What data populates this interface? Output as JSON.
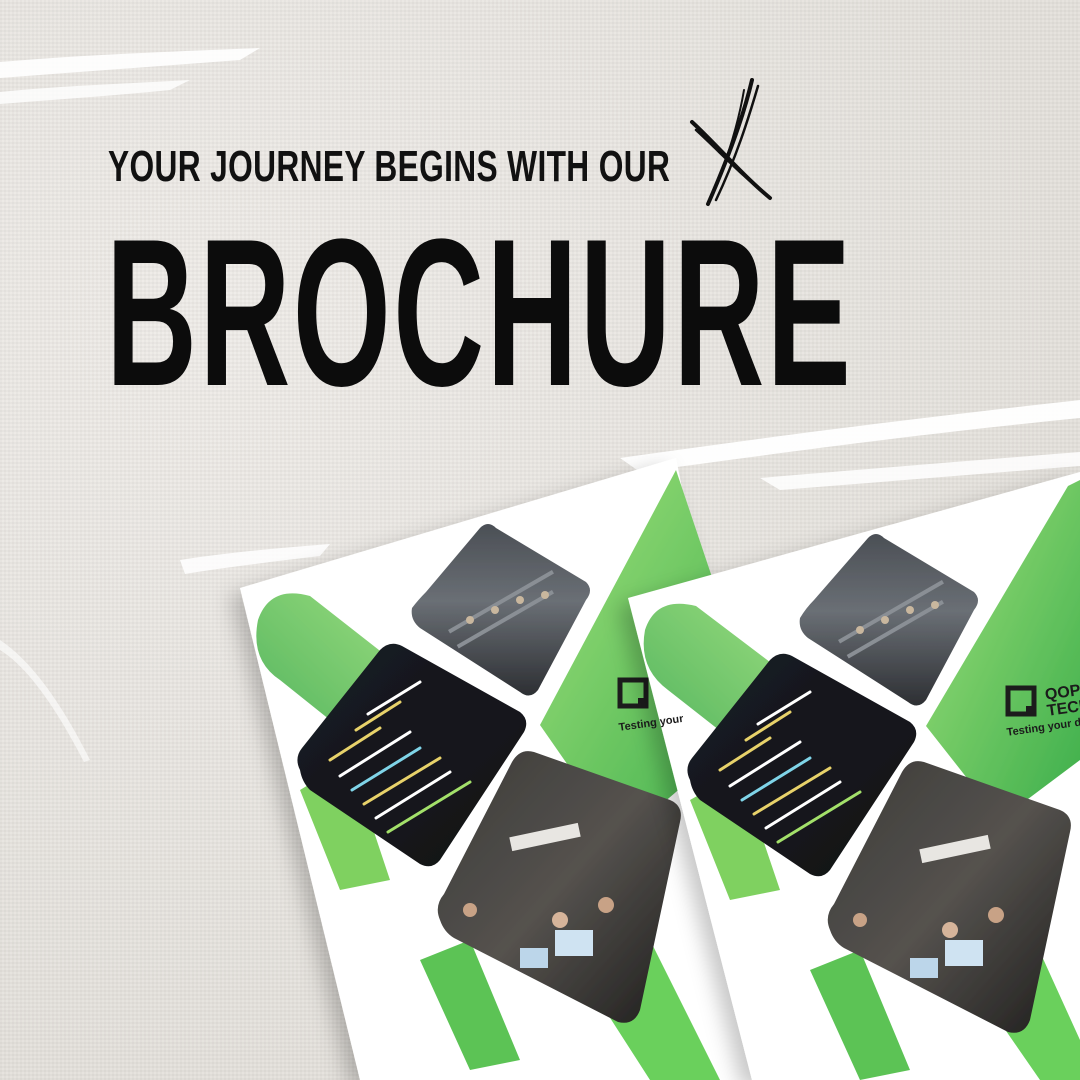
{
  "header": {
    "tagline": "YOUR JOURNEY BEGINS WITH OUR",
    "headline": "BROCHURE"
  },
  "brochure": {
    "logo_line1": "QOPS",
    "logo_line2": "TECH",
    "logo_tagline": "Testing your dreams",
    "logo_tagline_cropped": "Testing your"
  },
  "icons": {
    "cross_mark": "x-scribble-icon",
    "logo_mark": "square-logo-icon"
  },
  "colors": {
    "green_light": "#8fd86b",
    "green_dark": "#3fae4e",
    "ink": "#0c0c0c",
    "background": "#e9e6e1"
  }
}
